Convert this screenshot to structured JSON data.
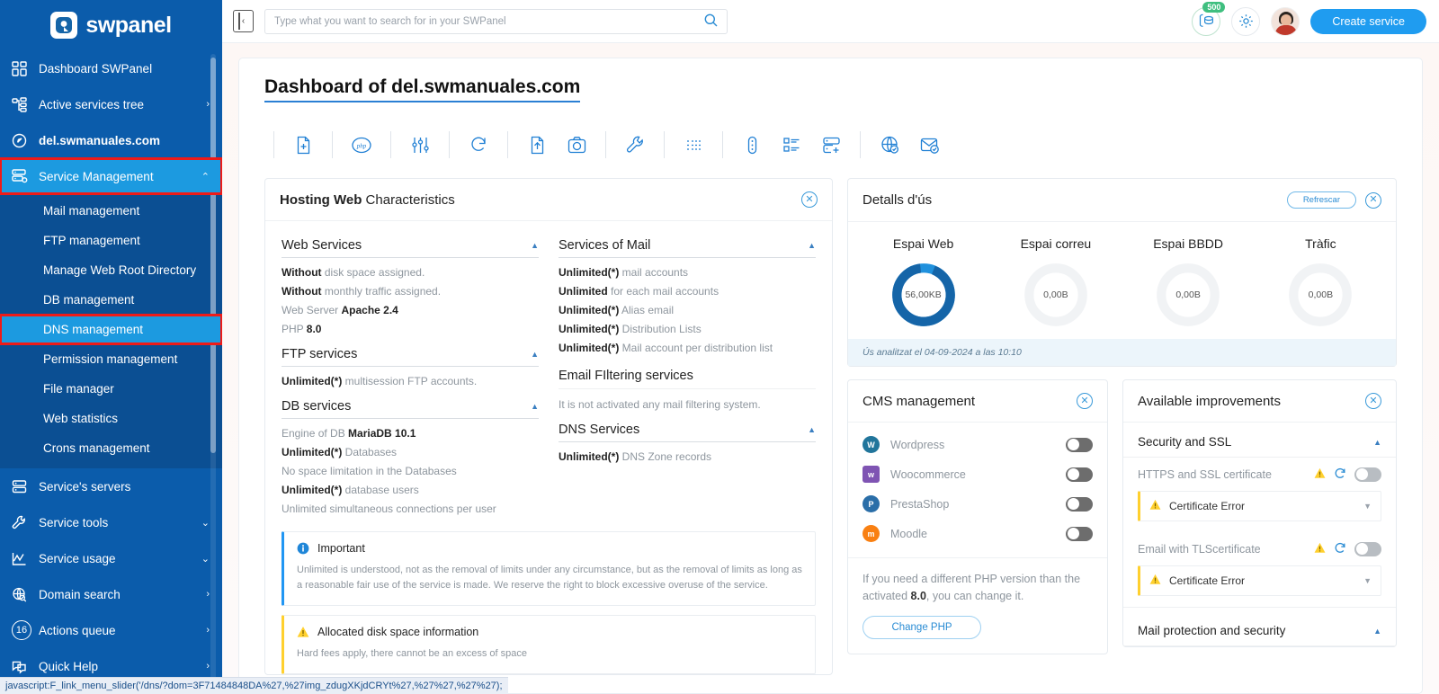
{
  "brand": {
    "name": "swpanel",
    "accent": "#1f9cf0",
    "sidebar_bg": "#0b5cab"
  },
  "topbar": {
    "collapse_icon": "collapse-sidebar-icon",
    "search_placeholder": "Type what you want to search for in your SWPanel",
    "search_value": "",
    "search_icon": "search-icon",
    "coins_icon": "coins-icon",
    "coins_badge": "500",
    "gear_icon": "gear-icon",
    "avatar": "user-avatar",
    "create_button": "Create service"
  },
  "sidebar": {
    "items": [
      {
        "label": "Dashboard SWPanel",
        "icon": "dashboard-grid-icon",
        "arrow": "",
        "state": "normal"
      },
      {
        "label": "Active services tree",
        "icon": "tree-icon",
        "arrow": "›",
        "state": "normal"
      },
      {
        "label": "del.swmanuales.com",
        "icon": "domain-circle-icon",
        "arrow": "",
        "state": "bold"
      },
      {
        "label": "Service Management",
        "icon": "server-gear-icon",
        "arrow": "⌃",
        "state": "active-highlight"
      }
    ],
    "submenu": [
      {
        "label": "Mail management",
        "state": "normal"
      },
      {
        "label": "FTP management",
        "state": "normal"
      },
      {
        "label": "Manage Web Root Directory",
        "state": "normal"
      },
      {
        "label": "DB management",
        "state": "normal"
      },
      {
        "label": "DNS management",
        "state": "active-highlight"
      },
      {
        "label": "Permission management",
        "state": "normal"
      },
      {
        "label": "File manager",
        "state": "normal"
      },
      {
        "label": "Web statistics",
        "state": "normal"
      },
      {
        "label": "Crons management",
        "state": "normal"
      }
    ],
    "items_bottom": [
      {
        "label": "Service's servers",
        "icon": "servers-icon",
        "arrow": "",
        "badge": ""
      },
      {
        "label": "Service tools",
        "icon": "wrench-icon",
        "arrow": "⌄",
        "badge": ""
      },
      {
        "label": "Service usage",
        "icon": "chart-line-icon",
        "arrow": "⌄",
        "badge": ""
      },
      {
        "label": "Domain search",
        "icon": "globe-search-icon",
        "arrow": "›",
        "badge": ""
      },
      {
        "label": "Actions queue",
        "icon": "queue-badge-icon",
        "arrow": "›",
        "badge": "16"
      },
      {
        "label": "Quick Help",
        "icon": "chat-help-icon",
        "arrow": "›",
        "badge": ""
      }
    ]
  },
  "page": {
    "title": "Dashboard of del.swmanuales.com",
    "toolbar_icons": [
      "new-file-icon",
      "php-icon",
      "settings-sliders-icon",
      "sync-icon",
      "upload-file-icon",
      "camera-icon",
      "wrench-tool-icon",
      "list-icon",
      "vertical-dots-icon",
      "list-detail-icon",
      "add-server-icon",
      "globe-check-icon",
      "mail-check-icon"
    ]
  },
  "hosting": {
    "title_bold": "Hosting Web",
    "title_rest": " Characteristics",
    "close_icon": "close-circle-icon",
    "left_sections": [
      {
        "title": "Web Services",
        "collapsible": true,
        "items": [
          {
            "b": "Without",
            "t": " disk space assigned."
          },
          {
            "b": "Without",
            "t": " monthly traffic assigned."
          },
          {
            "pre": "Web Server ",
            "b": "Apache 2.4",
            "t": ""
          },
          {
            "pre": "PHP ",
            "b": "8.0",
            "t": ""
          }
        ]
      },
      {
        "title": "FTP services",
        "collapsible": true,
        "items": [
          {
            "b": "Unlimited(*)",
            "t": " multisession FTP accounts."
          }
        ]
      },
      {
        "title": "DB services",
        "collapsible": true,
        "items": [
          {
            "pre": "Engine of DB ",
            "b": "MariaDB 10.1",
            "t": ""
          },
          {
            "b": "Unlimited(*)",
            "t": " Databases"
          },
          {
            "b": "",
            "t": "No space limitation in the Databases"
          },
          {
            "b": "Unlimited(*)",
            "t": " database users"
          },
          {
            "b": "",
            "t": "Unlimited simultaneous connections per user"
          }
        ]
      }
    ],
    "right_sections": [
      {
        "title": "Services of Mail",
        "collapsible": true,
        "items": [
          {
            "b": "Unlimited(*)",
            "t": " mail accounts"
          },
          {
            "b": "Unlimited",
            "t": " for each mail accounts"
          },
          {
            "b": "Unlimited(*)",
            "t": " Alias email"
          },
          {
            "b": "Unlimited(*)",
            "t": " Distribution Lists"
          },
          {
            "b": "Unlimited(*)",
            "t": " Mail account per distribution list"
          }
        ]
      },
      {
        "title": "Email FIltering services",
        "collapsible": false,
        "items": [
          {
            "b": "",
            "t": "It is not activated any mail filtering system."
          }
        ]
      },
      {
        "title": "DNS Services",
        "collapsible": true,
        "items": [
          {
            "b": "Unlimited(*)",
            "t": " DNS Zone records"
          }
        ]
      }
    ],
    "notes": [
      {
        "icon": "info-icon",
        "kind": "info",
        "title": "Important",
        "body": "Unlimited is understood, not as the removal of limits under any circumstance, but as the removal of limits as long as a reasonable fair use of the service is made. We reserve the right to block excessive overuse of the service."
      },
      {
        "icon": "warning-icon",
        "kind": "warn",
        "title": "Allocated disk space information",
        "body": "Hard fees apply, there cannot be an excess of space"
      }
    ]
  },
  "usage": {
    "title": "Detalls d'ús",
    "refresh_label": "Refrescar",
    "close_icon": "close-circle-icon",
    "cells": [
      {
        "label": "Espai Web",
        "value": "56,00KB",
        "percent": 92,
        "accent": "#1565a8",
        "accent2": "#2091dd"
      },
      {
        "label": "Espai correu",
        "value": "0,00B",
        "percent": 0,
        "accent": "#1565a8",
        "accent2": "#2091dd"
      },
      {
        "label": "Espai BBDD",
        "value": "0,00B",
        "percent": 0,
        "accent": "#1565a8",
        "accent2": "#2091dd"
      },
      {
        "label": "Tràfic",
        "value": "0,00B",
        "percent": 0,
        "accent": "#1565a8",
        "accent2": "#2091dd"
      }
    ],
    "footer": "Ús analitzat el 04-09-2024 a las 10:10"
  },
  "cms": {
    "title": "CMS management",
    "close_icon": "close-circle-icon",
    "rows": [
      {
        "name": "Wordpress",
        "icon": "wordpress-icon",
        "color": "#21759b",
        "glyph": "W",
        "on": false
      },
      {
        "name": "Woocommerce",
        "icon": "woocommerce-icon",
        "color": "#7f54b3",
        "glyph": "w",
        "on": false
      },
      {
        "name": "PrestaShop",
        "icon": "prestashop-icon",
        "color": "#2a6ea8",
        "glyph": "P",
        "on": false
      },
      {
        "name": "Moodle",
        "icon": "moodle-icon",
        "color": "#f98012",
        "glyph": "m",
        "on": false
      }
    ],
    "note_pre": "If you need a different PHP version than the activated ",
    "note_bold": "8.0",
    "note_post": ", you can change it.",
    "button": "Change PHP"
  },
  "improvements": {
    "title": "Available improvements",
    "close_icon": "close-circle-icon",
    "sections": [
      {
        "title": "Security and SSL",
        "rows": [
          {
            "name": "HTTPS and SSL certificate",
            "warning_icon": "warning-icon",
            "refresh_icon": "refresh-icon",
            "on": false,
            "error": "Certificate Error",
            "error_icon": "warning-icon",
            "chevron": "chevron-down-icon"
          },
          {
            "name": "Email with TLScertificate",
            "warning_icon": "warning-icon",
            "refresh_icon": "refresh-icon",
            "on": false,
            "error": "Certificate Error",
            "error_icon": "warning-icon",
            "chevron": "chevron-down-icon"
          }
        ]
      }
    ],
    "next_section_title": "Mail protection and security"
  },
  "statusbar": {
    "text": "javascript:F_link_menu_slider('/dns/?dom=3F71484848DA%27,%27img_zdugXKjdCRYt%27,%27%27,%27%27);"
  }
}
